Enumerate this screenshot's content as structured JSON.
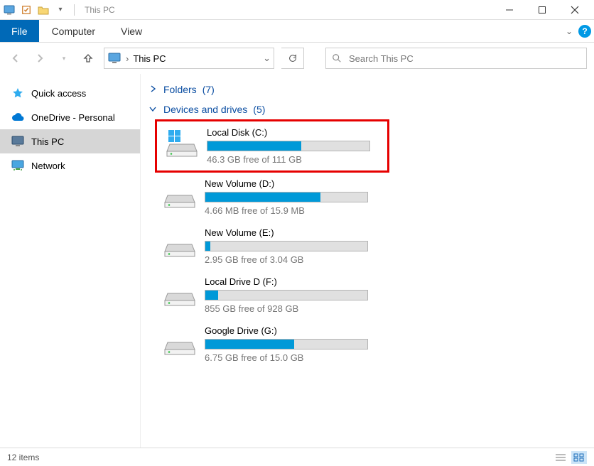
{
  "window": {
    "title": "This PC"
  },
  "ribbon": {
    "file": "File",
    "tabs": [
      "Computer",
      "View"
    ]
  },
  "nav": {
    "location": "This PC",
    "search_placeholder": "Search This PC"
  },
  "sidebar": {
    "items": [
      {
        "label": "Quick access",
        "icon": "star",
        "color": "#2facef"
      },
      {
        "label": "OneDrive - Personal",
        "icon": "cloud",
        "color": "#0078d4"
      },
      {
        "label": "This PC",
        "icon": "monitor",
        "color": "#4a6b8a"
      },
      {
        "label": "Network",
        "icon": "network",
        "color": "#3a9b3a"
      }
    ],
    "selected_index": 2
  },
  "groups": {
    "folders": {
      "label": "Folders",
      "count": "(7)",
      "expanded": false
    },
    "drives": {
      "label": "Devices and drives",
      "count": "(5)",
      "expanded": true
    }
  },
  "drives": [
    {
      "name": "Local Disk (C:)",
      "free_text": "46.3 GB free of 111 GB",
      "fill_pct": 58,
      "icon": "windows",
      "highlighted": true
    },
    {
      "name": "New Volume (D:)",
      "free_text": "4.66 MB free of 15.9 MB",
      "fill_pct": 71,
      "icon": "hdd"
    },
    {
      "name": "New Volume (E:)",
      "free_text": "2.95 GB free of 3.04 GB",
      "fill_pct": 3,
      "icon": "hdd"
    },
    {
      "name": "Local Drive D (F:)",
      "free_text": "855 GB free of 928 GB",
      "fill_pct": 8,
      "icon": "hdd"
    },
    {
      "name": "Google Drive (G:)",
      "free_text": "6.75 GB free of 15.0 GB",
      "fill_pct": 55,
      "icon": "hdd"
    }
  ],
  "status": {
    "items": "12 items"
  }
}
